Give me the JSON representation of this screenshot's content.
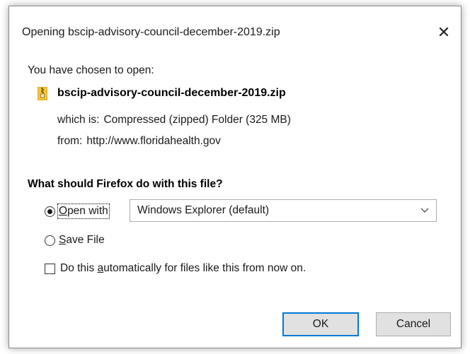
{
  "dialog": {
    "title": "Opening bscip-advisory-council-december-2019.zip",
    "close_glyph": "✕"
  },
  "content": {
    "chosen_label": "You have chosen to open:",
    "file_icon": "zip-file-icon",
    "file_name": "bscip-advisory-council-december-2019.zip",
    "which_is_label": "which is:",
    "which_is_value": "Compressed (zipped) Folder (325 MB)",
    "from_label": "from:",
    "from_value": "http://www.floridahealth.gov",
    "question": "What should Firefox do with this file?"
  },
  "options": {
    "open_with": {
      "mnemonic": "O",
      "rest": "pen with",
      "selected": true
    },
    "open_with_app": "Windows Explorer (default)",
    "save_file": {
      "mnemonic": "S",
      "rest": "ave File",
      "selected": false
    },
    "auto": {
      "before": "Do this ",
      "mnemonic": "a",
      "after": "utomatically for files like this from now on.",
      "checked": false
    }
  },
  "buttons": {
    "ok": "OK",
    "cancel": "Cancel"
  },
  "colors": {
    "accent": "#0078d7",
    "zip_icon": "#f0c040"
  }
}
